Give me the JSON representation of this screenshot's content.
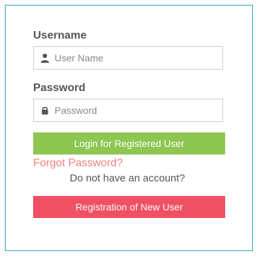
{
  "form": {
    "username_label": "Username",
    "username_placeholder": "User Name",
    "password_label": "Password",
    "password_placeholder": "Password",
    "login_button": "Login for Registered User",
    "forgot_link": "Forgot Password?",
    "no_account_text": "Do not have an account?",
    "register_button": "Registration of New User"
  },
  "icons": {
    "username": "user-icon",
    "password": "lock-icon"
  },
  "colors": {
    "border": "#2aa6c4",
    "login_button": "#8dc752",
    "register_button": "#f05063",
    "forgot_link": "#f08080",
    "text": "#555555"
  }
}
